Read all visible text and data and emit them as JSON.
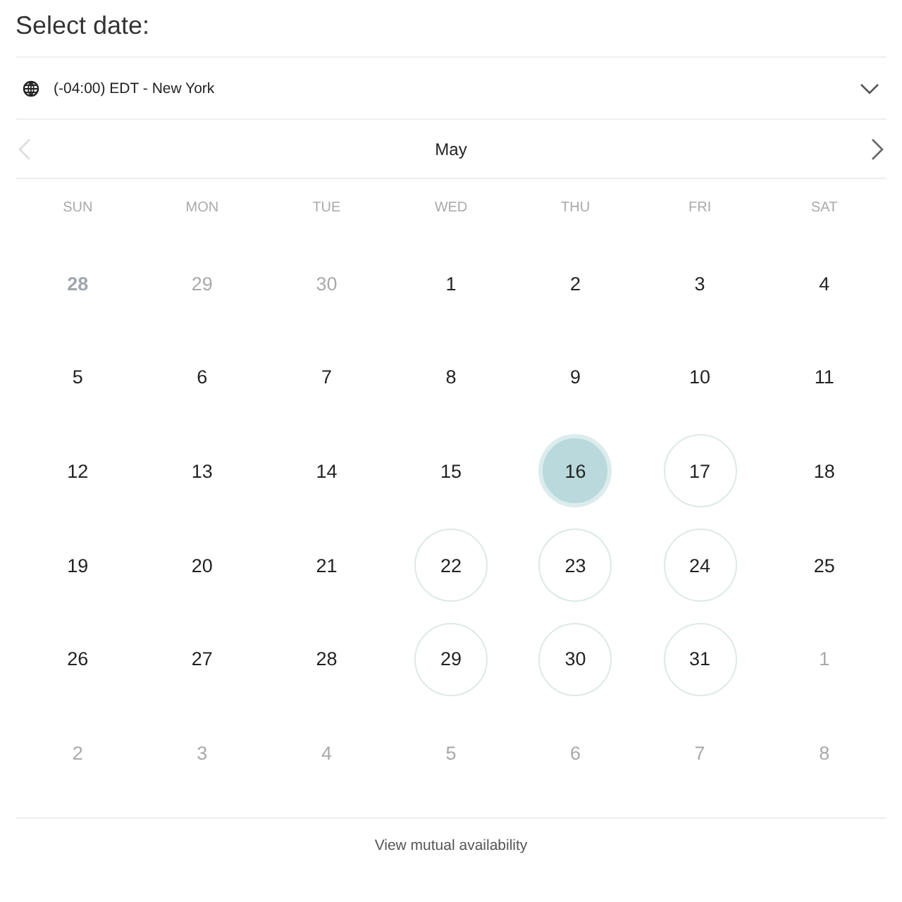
{
  "title": "Select date:",
  "timezone": {
    "label": "(-04:00) EDT - New York"
  },
  "month": {
    "label": "May",
    "prev_disabled": true
  },
  "weekdays": [
    "SUN",
    "MON",
    "TUE",
    "WED",
    "THU",
    "FRI",
    "SAT"
  ],
  "days": [
    {
      "label": "28",
      "kind": "outside-today",
      "selected": false
    },
    {
      "label": "29",
      "kind": "outside",
      "selected": false
    },
    {
      "label": "30",
      "kind": "outside",
      "selected": false
    },
    {
      "label": "1",
      "kind": "normal",
      "selected": false
    },
    {
      "label": "2",
      "kind": "normal",
      "selected": false
    },
    {
      "label": "3",
      "kind": "normal",
      "selected": false
    },
    {
      "label": "4",
      "kind": "normal",
      "selected": false
    },
    {
      "label": "5",
      "kind": "normal",
      "selected": false
    },
    {
      "label": "6",
      "kind": "normal",
      "selected": false
    },
    {
      "label": "7",
      "kind": "normal",
      "selected": false
    },
    {
      "label": "8",
      "kind": "normal",
      "selected": false
    },
    {
      "label": "9",
      "kind": "normal",
      "selected": false
    },
    {
      "label": "10",
      "kind": "normal",
      "selected": false
    },
    {
      "label": "11",
      "kind": "normal",
      "selected": false
    },
    {
      "label": "12",
      "kind": "normal",
      "selected": false
    },
    {
      "label": "13",
      "kind": "normal",
      "selected": false
    },
    {
      "label": "14",
      "kind": "normal",
      "selected": false
    },
    {
      "label": "15",
      "kind": "normal",
      "selected": false
    },
    {
      "label": "16",
      "kind": "available",
      "selected": true
    },
    {
      "label": "17",
      "kind": "available",
      "selected": false
    },
    {
      "label": "18",
      "kind": "normal",
      "selected": false
    },
    {
      "label": "19",
      "kind": "normal",
      "selected": false
    },
    {
      "label": "20",
      "kind": "normal",
      "selected": false
    },
    {
      "label": "21",
      "kind": "normal",
      "selected": false
    },
    {
      "label": "22",
      "kind": "available",
      "selected": false
    },
    {
      "label": "23",
      "kind": "available",
      "selected": false
    },
    {
      "label": "24",
      "kind": "available",
      "selected": false
    },
    {
      "label": "25",
      "kind": "normal",
      "selected": false
    },
    {
      "label": "26",
      "kind": "normal",
      "selected": false
    },
    {
      "label": "27",
      "kind": "normal",
      "selected": false
    },
    {
      "label": "28",
      "kind": "normal",
      "selected": false
    },
    {
      "label": "29",
      "kind": "available",
      "selected": false
    },
    {
      "label": "30",
      "kind": "available",
      "selected": false
    },
    {
      "label": "31",
      "kind": "available",
      "selected": false
    },
    {
      "label": "1",
      "kind": "outside",
      "selected": false
    },
    {
      "label": "2",
      "kind": "outside",
      "selected": false
    },
    {
      "label": "3",
      "kind": "outside",
      "selected": false
    },
    {
      "label": "4",
      "kind": "outside",
      "selected": false
    },
    {
      "label": "5",
      "kind": "outside",
      "selected": false
    },
    {
      "label": "6",
      "kind": "outside",
      "selected": false
    },
    {
      "label": "7",
      "kind": "outside",
      "selected": false
    },
    {
      "label": "8",
      "kind": "outside",
      "selected": false
    }
  ],
  "footer_link": "View mutual availability"
}
